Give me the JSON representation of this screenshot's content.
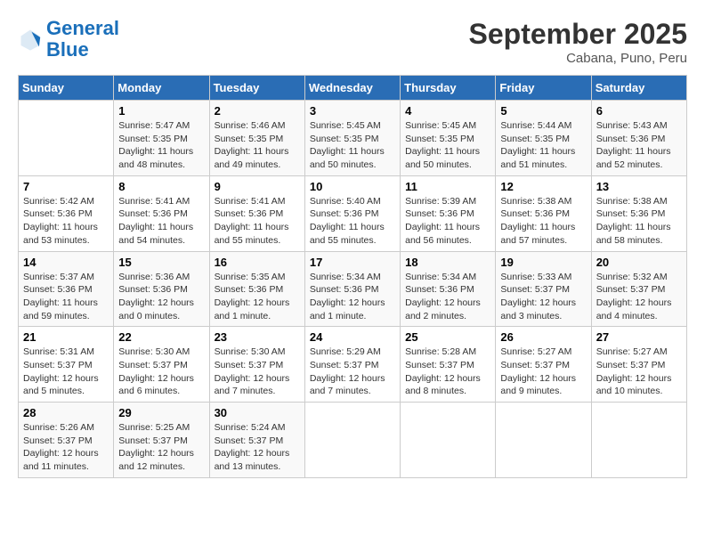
{
  "header": {
    "logo_general": "General",
    "logo_blue": "Blue",
    "month": "September 2025",
    "location": "Cabana, Puno, Peru"
  },
  "days_of_week": [
    "Sunday",
    "Monday",
    "Tuesday",
    "Wednesday",
    "Thursday",
    "Friday",
    "Saturday"
  ],
  "weeks": [
    [
      {
        "day": "",
        "info": ""
      },
      {
        "day": "1",
        "info": "Sunrise: 5:47 AM\nSunset: 5:35 PM\nDaylight: 11 hours\nand 48 minutes."
      },
      {
        "day": "2",
        "info": "Sunrise: 5:46 AM\nSunset: 5:35 PM\nDaylight: 11 hours\nand 49 minutes."
      },
      {
        "day": "3",
        "info": "Sunrise: 5:45 AM\nSunset: 5:35 PM\nDaylight: 11 hours\nand 50 minutes."
      },
      {
        "day": "4",
        "info": "Sunrise: 5:45 AM\nSunset: 5:35 PM\nDaylight: 11 hours\nand 50 minutes."
      },
      {
        "day": "5",
        "info": "Sunrise: 5:44 AM\nSunset: 5:35 PM\nDaylight: 11 hours\nand 51 minutes."
      },
      {
        "day": "6",
        "info": "Sunrise: 5:43 AM\nSunset: 5:36 PM\nDaylight: 11 hours\nand 52 minutes."
      }
    ],
    [
      {
        "day": "7",
        "info": "Sunrise: 5:42 AM\nSunset: 5:36 PM\nDaylight: 11 hours\nand 53 minutes."
      },
      {
        "day": "8",
        "info": "Sunrise: 5:41 AM\nSunset: 5:36 PM\nDaylight: 11 hours\nand 54 minutes."
      },
      {
        "day": "9",
        "info": "Sunrise: 5:41 AM\nSunset: 5:36 PM\nDaylight: 11 hours\nand 55 minutes."
      },
      {
        "day": "10",
        "info": "Sunrise: 5:40 AM\nSunset: 5:36 PM\nDaylight: 11 hours\nand 55 minutes."
      },
      {
        "day": "11",
        "info": "Sunrise: 5:39 AM\nSunset: 5:36 PM\nDaylight: 11 hours\nand 56 minutes."
      },
      {
        "day": "12",
        "info": "Sunrise: 5:38 AM\nSunset: 5:36 PM\nDaylight: 11 hours\nand 57 minutes."
      },
      {
        "day": "13",
        "info": "Sunrise: 5:38 AM\nSunset: 5:36 PM\nDaylight: 11 hours\nand 58 minutes."
      }
    ],
    [
      {
        "day": "14",
        "info": "Sunrise: 5:37 AM\nSunset: 5:36 PM\nDaylight: 11 hours\nand 59 minutes."
      },
      {
        "day": "15",
        "info": "Sunrise: 5:36 AM\nSunset: 5:36 PM\nDaylight: 12 hours\nand 0 minutes."
      },
      {
        "day": "16",
        "info": "Sunrise: 5:35 AM\nSunset: 5:36 PM\nDaylight: 12 hours\nand 1 minute."
      },
      {
        "day": "17",
        "info": "Sunrise: 5:34 AM\nSunset: 5:36 PM\nDaylight: 12 hours\nand 1 minute."
      },
      {
        "day": "18",
        "info": "Sunrise: 5:34 AM\nSunset: 5:36 PM\nDaylight: 12 hours\nand 2 minutes."
      },
      {
        "day": "19",
        "info": "Sunrise: 5:33 AM\nSunset: 5:37 PM\nDaylight: 12 hours\nand 3 minutes."
      },
      {
        "day": "20",
        "info": "Sunrise: 5:32 AM\nSunset: 5:37 PM\nDaylight: 12 hours\nand 4 minutes."
      }
    ],
    [
      {
        "day": "21",
        "info": "Sunrise: 5:31 AM\nSunset: 5:37 PM\nDaylight: 12 hours\nand 5 minutes."
      },
      {
        "day": "22",
        "info": "Sunrise: 5:30 AM\nSunset: 5:37 PM\nDaylight: 12 hours\nand 6 minutes."
      },
      {
        "day": "23",
        "info": "Sunrise: 5:30 AM\nSunset: 5:37 PM\nDaylight: 12 hours\nand 7 minutes."
      },
      {
        "day": "24",
        "info": "Sunrise: 5:29 AM\nSunset: 5:37 PM\nDaylight: 12 hours\nand 7 minutes."
      },
      {
        "day": "25",
        "info": "Sunrise: 5:28 AM\nSunset: 5:37 PM\nDaylight: 12 hours\nand 8 minutes."
      },
      {
        "day": "26",
        "info": "Sunrise: 5:27 AM\nSunset: 5:37 PM\nDaylight: 12 hours\nand 9 minutes."
      },
      {
        "day": "27",
        "info": "Sunrise: 5:27 AM\nSunset: 5:37 PM\nDaylight: 12 hours\nand 10 minutes."
      }
    ],
    [
      {
        "day": "28",
        "info": "Sunrise: 5:26 AM\nSunset: 5:37 PM\nDaylight: 12 hours\nand 11 minutes."
      },
      {
        "day": "29",
        "info": "Sunrise: 5:25 AM\nSunset: 5:37 PM\nDaylight: 12 hours\nand 12 minutes."
      },
      {
        "day": "30",
        "info": "Sunrise: 5:24 AM\nSunset: 5:37 PM\nDaylight: 12 hours\nand 13 minutes."
      },
      {
        "day": "",
        "info": ""
      },
      {
        "day": "",
        "info": ""
      },
      {
        "day": "",
        "info": ""
      },
      {
        "day": "",
        "info": ""
      }
    ]
  ]
}
